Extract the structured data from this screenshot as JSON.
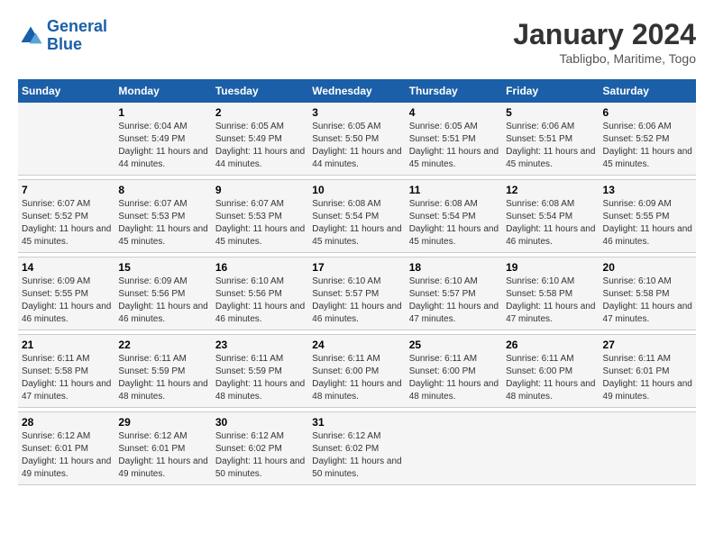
{
  "header": {
    "logo_general": "General",
    "logo_blue": "Blue",
    "title": "January 2024",
    "location": "Tabligbo, Maritime, Togo"
  },
  "days_of_week": [
    "Sunday",
    "Monday",
    "Tuesday",
    "Wednesday",
    "Thursday",
    "Friday",
    "Saturday"
  ],
  "weeks": [
    [
      {
        "day": "",
        "sunrise": "",
        "sunset": "",
        "daylight": ""
      },
      {
        "day": "1",
        "sunrise": "Sunrise: 6:04 AM",
        "sunset": "Sunset: 5:49 PM",
        "daylight": "Daylight: 11 hours and 44 minutes."
      },
      {
        "day": "2",
        "sunrise": "Sunrise: 6:05 AM",
        "sunset": "Sunset: 5:49 PM",
        "daylight": "Daylight: 11 hours and 44 minutes."
      },
      {
        "day": "3",
        "sunrise": "Sunrise: 6:05 AM",
        "sunset": "Sunset: 5:50 PM",
        "daylight": "Daylight: 11 hours and 44 minutes."
      },
      {
        "day": "4",
        "sunrise": "Sunrise: 6:05 AM",
        "sunset": "Sunset: 5:51 PM",
        "daylight": "Daylight: 11 hours and 45 minutes."
      },
      {
        "day": "5",
        "sunrise": "Sunrise: 6:06 AM",
        "sunset": "Sunset: 5:51 PM",
        "daylight": "Daylight: 11 hours and 45 minutes."
      },
      {
        "day": "6",
        "sunrise": "Sunrise: 6:06 AM",
        "sunset": "Sunset: 5:52 PM",
        "daylight": "Daylight: 11 hours and 45 minutes."
      }
    ],
    [
      {
        "day": "7",
        "sunrise": "Sunrise: 6:07 AM",
        "sunset": "Sunset: 5:52 PM",
        "daylight": "Daylight: 11 hours and 45 minutes."
      },
      {
        "day": "8",
        "sunrise": "Sunrise: 6:07 AM",
        "sunset": "Sunset: 5:53 PM",
        "daylight": "Daylight: 11 hours and 45 minutes."
      },
      {
        "day": "9",
        "sunrise": "Sunrise: 6:07 AM",
        "sunset": "Sunset: 5:53 PM",
        "daylight": "Daylight: 11 hours and 45 minutes."
      },
      {
        "day": "10",
        "sunrise": "Sunrise: 6:08 AM",
        "sunset": "Sunset: 5:54 PM",
        "daylight": "Daylight: 11 hours and 45 minutes."
      },
      {
        "day": "11",
        "sunrise": "Sunrise: 6:08 AM",
        "sunset": "Sunset: 5:54 PM",
        "daylight": "Daylight: 11 hours and 45 minutes."
      },
      {
        "day": "12",
        "sunrise": "Sunrise: 6:08 AM",
        "sunset": "Sunset: 5:54 PM",
        "daylight": "Daylight: 11 hours and 46 minutes."
      },
      {
        "day": "13",
        "sunrise": "Sunrise: 6:09 AM",
        "sunset": "Sunset: 5:55 PM",
        "daylight": "Daylight: 11 hours and 46 minutes."
      }
    ],
    [
      {
        "day": "14",
        "sunrise": "Sunrise: 6:09 AM",
        "sunset": "Sunset: 5:55 PM",
        "daylight": "Daylight: 11 hours and 46 minutes."
      },
      {
        "day": "15",
        "sunrise": "Sunrise: 6:09 AM",
        "sunset": "Sunset: 5:56 PM",
        "daylight": "Daylight: 11 hours and 46 minutes."
      },
      {
        "day": "16",
        "sunrise": "Sunrise: 6:10 AM",
        "sunset": "Sunset: 5:56 PM",
        "daylight": "Daylight: 11 hours and 46 minutes."
      },
      {
        "day": "17",
        "sunrise": "Sunrise: 6:10 AM",
        "sunset": "Sunset: 5:57 PM",
        "daylight": "Daylight: 11 hours and 46 minutes."
      },
      {
        "day": "18",
        "sunrise": "Sunrise: 6:10 AM",
        "sunset": "Sunset: 5:57 PM",
        "daylight": "Daylight: 11 hours and 47 minutes."
      },
      {
        "day": "19",
        "sunrise": "Sunrise: 6:10 AM",
        "sunset": "Sunset: 5:58 PM",
        "daylight": "Daylight: 11 hours and 47 minutes."
      },
      {
        "day": "20",
        "sunrise": "Sunrise: 6:10 AM",
        "sunset": "Sunset: 5:58 PM",
        "daylight": "Daylight: 11 hours and 47 minutes."
      }
    ],
    [
      {
        "day": "21",
        "sunrise": "Sunrise: 6:11 AM",
        "sunset": "Sunset: 5:58 PM",
        "daylight": "Daylight: 11 hours and 47 minutes."
      },
      {
        "day": "22",
        "sunrise": "Sunrise: 6:11 AM",
        "sunset": "Sunset: 5:59 PM",
        "daylight": "Daylight: 11 hours and 48 minutes."
      },
      {
        "day": "23",
        "sunrise": "Sunrise: 6:11 AM",
        "sunset": "Sunset: 5:59 PM",
        "daylight": "Daylight: 11 hours and 48 minutes."
      },
      {
        "day": "24",
        "sunrise": "Sunrise: 6:11 AM",
        "sunset": "Sunset: 6:00 PM",
        "daylight": "Daylight: 11 hours and 48 minutes."
      },
      {
        "day": "25",
        "sunrise": "Sunrise: 6:11 AM",
        "sunset": "Sunset: 6:00 PM",
        "daylight": "Daylight: 11 hours and 48 minutes."
      },
      {
        "day": "26",
        "sunrise": "Sunrise: 6:11 AM",
        "sunset": "Sunset: 6:00 PM",
        "daylight": "Daylight: 11 hours and 48 minutes."
      },
      {
        "day": "27",
        "sunrise": "Sunrise: 6:11 AM",
        "sunset": "Sunset: 6:01 PM",
        "daylight": "Daylight: 11 hours and 49 minutes."
      }
    ],
    [
      {
        "day": "28",
        "sunrise": "Sunrise: 6:12 AM",
        "sunset": "Sunset: 6:01 PM",
        "daylight": "Daylight: 11 hours and 49 minutes."
      },
      {
        "day": "29",
        "sunrise": "Sunrise: 6:12 AM",
        "sunset": "Sunset: 6:01 PM",
        "daylight": "Daylight: 11 hours and 49 minutes."
      },
      {
        "day": "30",
        "sunrise": "Sunrise: 6:12 AM",
        "sunset": "Sunset: 6:02 PM",
        "daylight": "Daylight: 11 hours and 50 minutes."
      },
      {
        "day": "31",
        "sunrise": "Sunrise: 6:12 AM",
        "sunset": "Sunset: 6:02 PM",
        "daylight": "Daylight: 11 hours and 50 minutes."
      },
      {
        "day": "",
        "sunrise": "",
        "sunset": "",
        "daylight": ""
      },
      {
        "day": "",
        "sunrise": "",
        "sunset": "",
        "daylight": ""
      },
      {
        "day": "",
        "sunrise": "",
        "sunset": "",
        "daylight": ""
      }
    ]
  ]
}
